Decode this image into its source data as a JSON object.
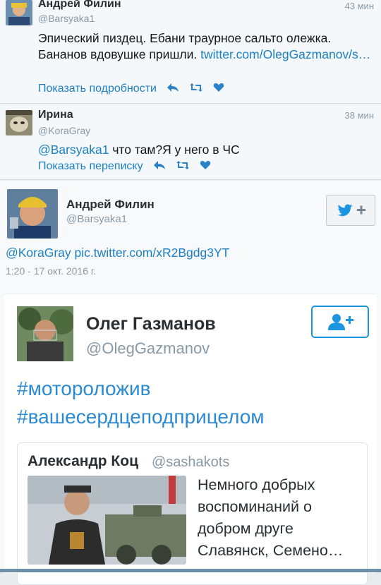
{
  "tweets": [
    {
      "name": "Андрей Филин",
      "handle": "@Barsyaka1",
      "time": "43 мин",
      "text_plain": "Эпический пиздец. Ебани траурное сальто олежка. Бананов вдовушке пришли. ",
      "text_link": "twitter.com/OlegGazmanov/s…",
      "action_label": "Показать подробности"
    },
    {
      "name": "Ирина",
      "handle": "@KoraGray",
      "time": "38 мин",
      "text_mention": "@Barsyaka1",
      "text_plain": " что там?Я у него в ЧС",
      "action_label": "Показать переписку"
    }
  ],
  "detail": {
    "name": "Андрей Филин",
    "handle": "@Barsyaka1",
    "text": "@KoraGray pic.twitter.com/xR2Bgdg3YT",
    "date": "1:20 - 17 окт. 2016 г."
  },
  "embed": {
    "name": "Олег Газманов",
    "handle": "@OlegGazmanov",
    "hashtag1": "#мотороложив",
    "hashtag2": "#вашесердцеподприцелом",
    "quote": {
      "name": "Александр Коц",
      "handle": "@sashakots",
      "text": "Немного добрых воспоминаний о добром друге Славянск, Семено…"
    }
  },
  "icons": {
    "reply": "reply-icon",
    "retweet": "retweet-icon",
    "like": "heart-icon",
    "follow": "follow-icon"
  },
  "colors": {
    "link": "#1b80c4",
    "muted": "#8899a6",
    "follow_blue": "#1b95e0"
  }
}
